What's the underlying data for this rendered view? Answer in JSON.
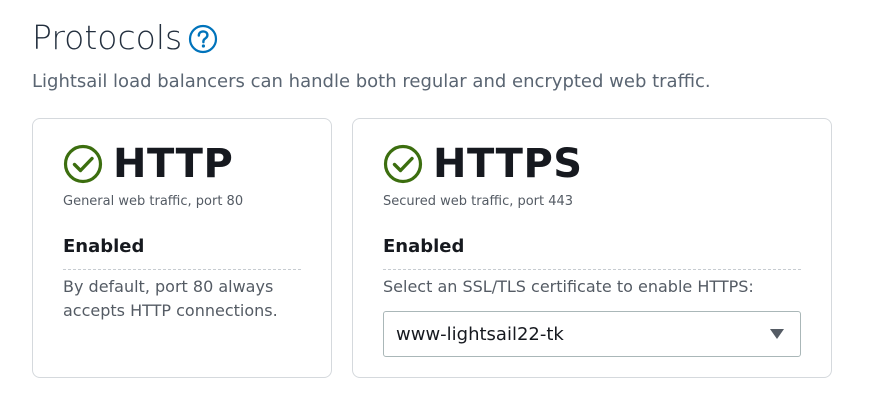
{
  "section": {
    "title": "Protocols",
    "help_icon": "question-circle-icon",
    "description": "Lightsail load balancers can handle both regular and encrypted web traffic."
  },
  "http_card": {
    "icon": "check-circle-icon",
    "title": "HTTP",
    "subtitle": "General web traffic, port 80",
    "status": "Enabled",
    "body": "By default, port 80 always accepts HTTP connections."
  },
  "https_card": {
    "icon": "check-circle-icon",
    "title": "HTTPS",
    "subtitle": "Secured web traffic, port 443",
    "status": "Enabled",
    "body": "Select an SSL/TLS certificate to enable HTTPS:",
    "certificate_select": {
      "selected_value": "www-lightsail22-tk",
      "caret_icon": "caret-down-icon"
    }
  },
  "colors": {
    "check_green": "#3c6e0f",
    "help_blue": "#0073bb",
    "card_border": "#d5d9dd"
  }
}
